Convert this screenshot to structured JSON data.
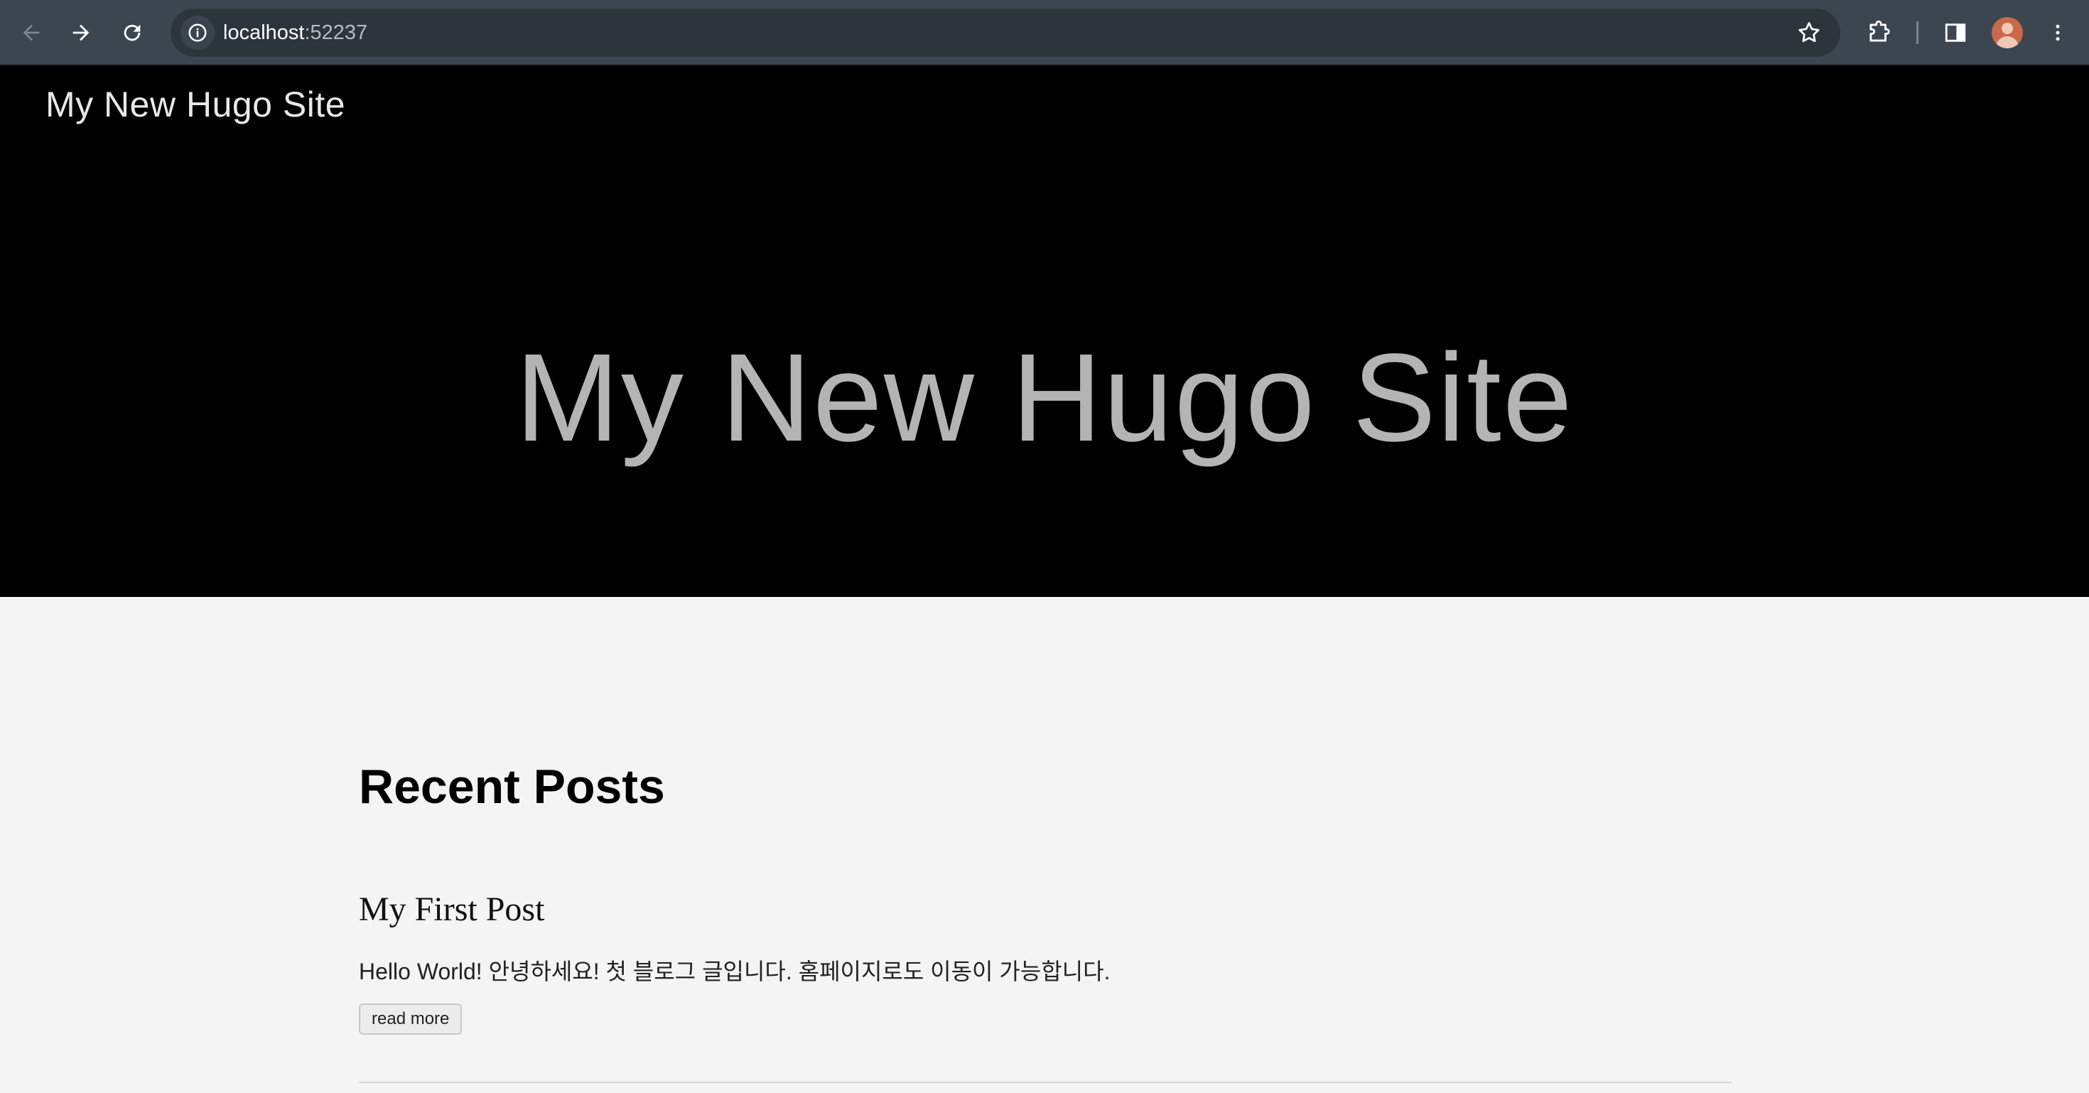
{
  "browser": {
    "url_host": "localhost",
    "url_port": ":52237",
    "icons": [
      "back-arrow-icon",
      "forward-arrow-icon",
      "reload-icon",
      "site-info-icon",
      "star-icon",
      "extensions-icon",
      "side-panel-icon",
      "profile-avatar",
      "kebab-menu-icon"
    ]
  },
  "site": {
    "brand": "My New Hugo Site",
    "hero_title": "My New Hugo Site"
  },
  "recent": {
    "heading": "Recent Posts",
    "posts": [
      {
        "title": "My First Post",
        "summary": "Hello World! 안녕하세요! 첫 블로그 글입니다. 홈페이지로도 이동이 가능합니다.",
        "read_more": "read more"
      }
    ]
  },
  "colors": {
    "chrome_bg": "#3c4650",
    "omnibox_bg": "#2c343c",
    "hero_bg": "#000000",
    "page_bg": "#f4f4f4"
  }
}
